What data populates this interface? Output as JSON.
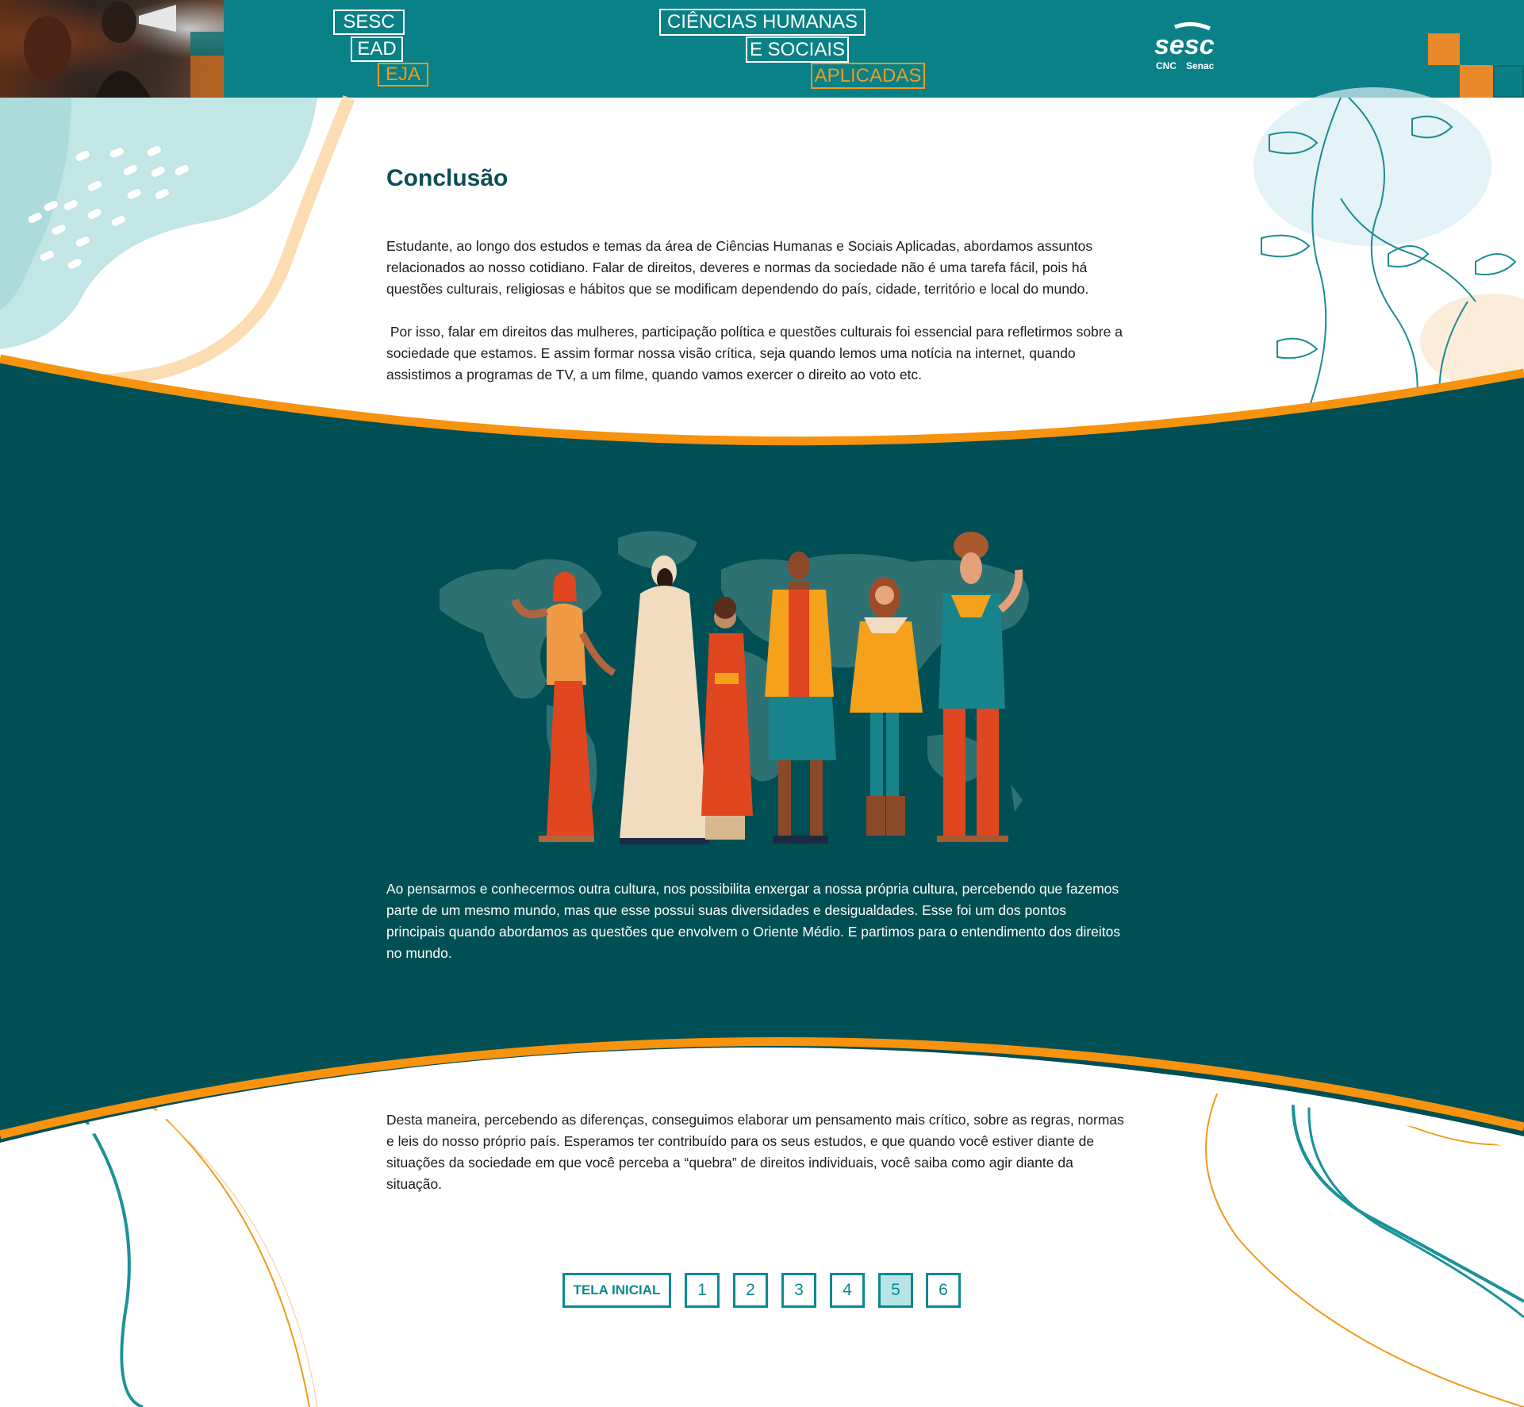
{
  "header": {
    "logo_lines": [
      "SESC",
      "EAD",
      "EJA"
    ],
    "course_title_lines": [
      "CIÊNCIAS HUMANAS",
      "E SOCIAIS",
      "APLICADAS"
    ],
    "brand_logo": "sesc",
    "brand_sub": [
      "CNC",
      "Senac"
    ],
    "colors": {
      "header_bg": "#0a8186",
      "accent_orange": "#f29a1a",
      "text_white": "#ffffff"
    }
  },
  "content": {
    "title": "Conclusão",
    "paragraph_1": "Estudante, ao longo dos estudos e temas da área de Ciências Humanas e Sociais Aplicadas, abordamos assuntos relacionados ao nosso cotidiano. Falar de direitos, deveres e normas da sociedade não é uma tarefa fácil, pois há questões culturais, religiosas e hábitos que se modificam dependendo do país, cidade, território e local do mundo.",
    "paragraph_2": " Por isso, falar em direitos das mulheres, participação política e questões culturais foi essencial para refletirmos sobre a sociedade que estamos. E assim formar nossa visão crítica, seja quando lemos uma notícia na internet, quando assistimos a programas de TV, a um filme, quando vamos exercer o direito ao voto etc.",
    "paragraph_3": "Ao pensarmos e conhecermos outra cultura, nos possibilita enxergar a nossa própria cultura, percebendo que fazemos parte de um mesmo mundo, mas que esse possui suas diversidades e desigualdades. Esse foi um dos pontos principais quando abordamos as questões que envolvem o Oriente Médio. E partimos para o entendimento dos direitos no mundo.",
    "paragraph_4": "Desta maneira, percebendo as diferenças, conseguimos elaborar um pensamento mais crítico, sobre as regras, normas e leis do nosso próprio país. Esperamos ter contribuído para os seus estudos, e que quando você estiver diante de situações da sociedade em que você perceba a “quebra” de direitos individuais, você saiba como agir diante da situação.",
    "colors": {
      "band_bg": "#004f55",
      "band_border": "#f7930e",
      "title": "#0b4f55"
    }
  },
  "illustration": {
    "name": "diverse-people-world-map-illustration"
  },
  "pagination": {
    "home_label": "TELA INICIAL",
    "pages": [
      "1",
      "2",
      "3",
      "4",
      "5",
      "6"
    ],
    "current_page": "5",
    "colors": {
      "border": "#0b8a8e",
      "active_bg": "#b9e4e6"
    }
  }
}
